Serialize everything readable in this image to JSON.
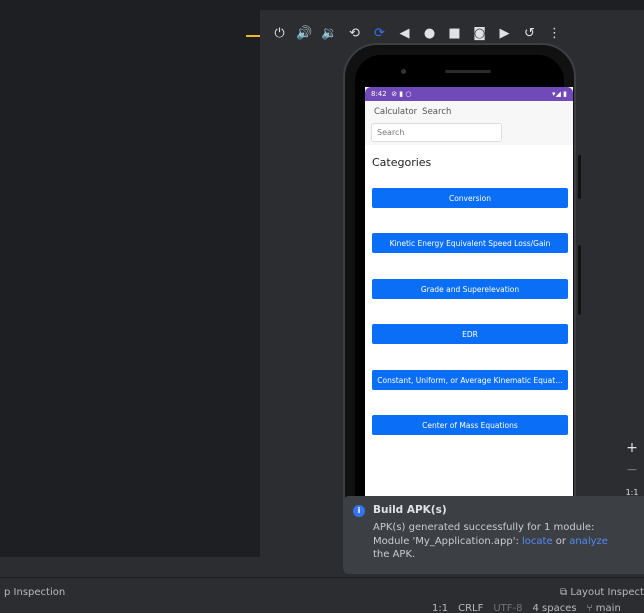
{
  "emulator_toolbar": {
    "icons": [
      "power-icon",
      "volume-up-icon",
      "volume-down-icon",
      "rotate-left-icon",
      "rotate-right-icon",
      "back-icon",
      "home-icon",
      "overview-icon",
      "camera-icon",
      "record-icon",
      "undo-icon",
      "more-icon"
    ]
  },
  "phone": {
    "status_time": "8:42",
    "status_icons_left": "⊘ ▮ ○",
    "status_icons_right": "▾◢ ▮",
    "tabs": [
      "Calculator",
      "Search"
    ],
    "search_placeholder": "Search",
    "categories_title": "Categories",
    "category_buttons": [
      "Conversion",
      "Kinetic Energy Equivalent Speed Loss/Gain",
      "Grade and Superelevation",
      "EDR",
      "Constant, Uniform, or Average Kinematic Equat…",
      "Center of Mass Equations"
    ]
  },
  "zoom": {
    "plus": "+",
    "minus": "−",
    "one_to_one": "1:1"
  },
  "notification": {
    "title": "Build APK(s)",
    "line1": "APK(s) generated successfully for 1 module:",
    "line2_prefix": "Module 'My_Application.app': ",
    "locate": "locate",
    "or": " or ",
    "analyze": "analyze",
    "line3": "the APK."
  },
  "bottom": {
    "left_tool": "p Inspection",
    "right_tool": "Layout Inspecto",
    "position": "1:1",
    "line_sep": "CRLF",
    "encoding": "UTF-8",
    "indent": "4 spaces",
    "branch": "main"
  },
  "colors": {
    "accent": "#3574f0",
    "app_button": "#0a6ef7",
    "status_bar": "#6f4ab8"
  }
}
